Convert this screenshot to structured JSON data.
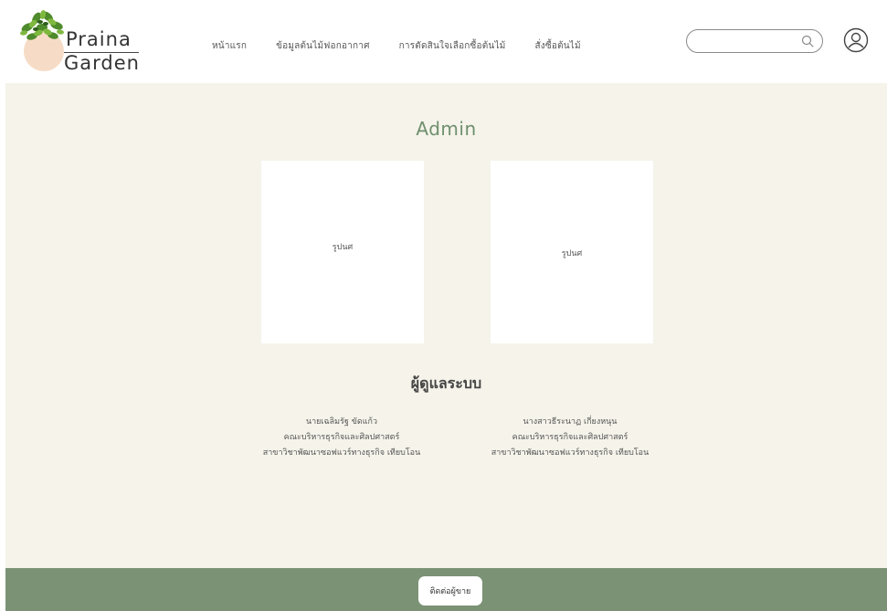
{
  "brand": {
    "line1": "Praina",
    "line2": "Garden"
  },
  "nav": {
    "items": [
      {
        "label": "หน้าแรก"
      },
      {
        "label": "ข้อมูลต้นไม้ฟอกอากาศ"
      },
      {
        "label": "การตัดสินใจเลือกซื้อต้นไม้"
      },
      {
        "label": "สั่งซื้อต้นไม้"
      }
    ]
  },
  "search": {
    "value": "",
    "placeholder": "",
    "icon": "search-icon"
  },
  "account": {
    "icon": "user-icon"
  },
  "main": {
    "title": "Admin",
    "photos": [
      {
        "label": "รูปนศ"
      },
      {
        "label": "รูปนศ"
      }
    ],
    "section_title": "ผู้ดูแลระบบ",
    "admins": [
      {
        "name": "นายเฉลิมรัฐ  ขัดแก้ว",
        "faculty": "คณะบริหารธุรกิจและศิลปศาสตร์",
        "major": "สาขาวิชาพัฒนาซอฟแวร์ทางธุรกิจ เทียบโอน"
      },
      {
        "name": "นางสาวธีระนาฏ  เกี่ยงหนุน",
        "faculty": "คณะบริหารธุรกิจและศิลปศาสตร์",
        "major": "สาขาวิชาพัฒนาซอฟแวร์ทางธุรกิจ เทียบโอน"
      }
    ]
  },
  "footer": {
    "contact_label": "ติดต่อผู้ขาย"
  },
  "colors": {
    "accent_green": "#6f8f6e",
    "footer_green": "#7b9275",
    "background": "#f5f3ea",
    "pot": "#f6dcc6"
  }
}
